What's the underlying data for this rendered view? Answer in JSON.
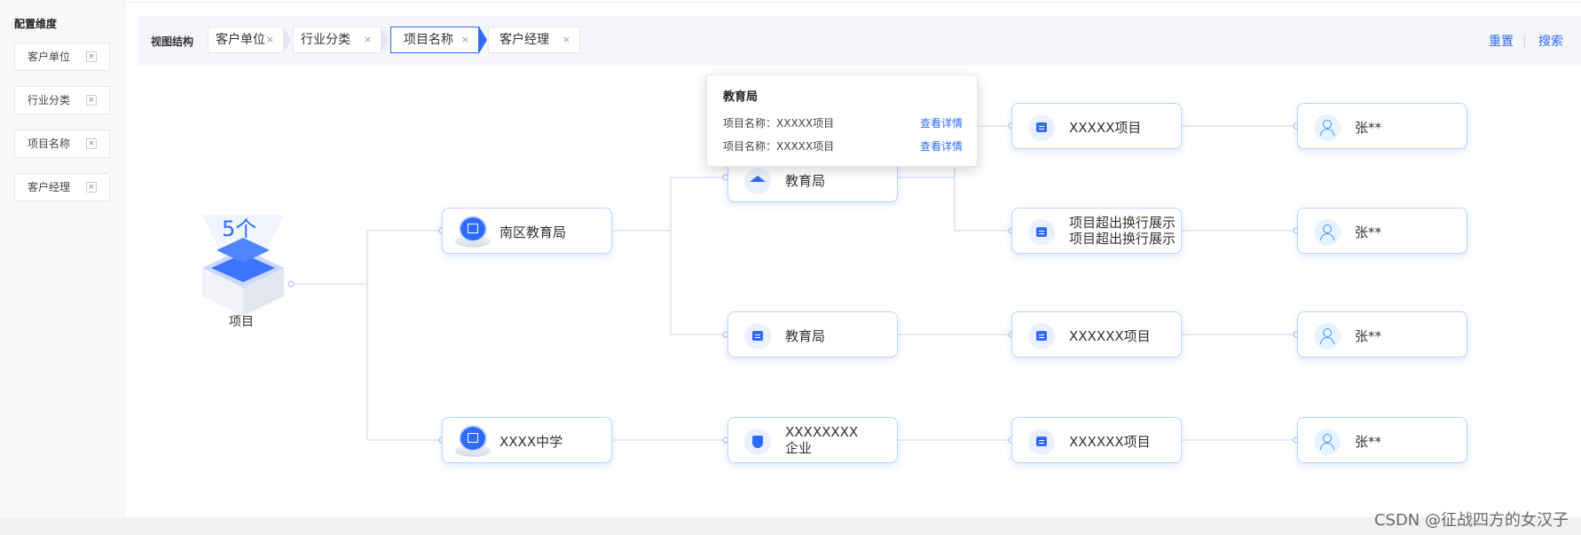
{
  "sidebar": {
    "title": "配置维度",
    "items": [
      {
        "label": "客户单位"
      },
      {
        "label": "行业分类"
      },
      {
        "label": "项目名称"
      },
      {
        "label": "客户经理"
      }
    ]
  },
  "header": {
    "view_label": "视图结构",
    "crumbs": [
      {
        "label": "客户单位"
      },
      {
        "label": "行业分类"
      },
      {
        "label": "项目名称",
        "active": true
      },
      {
        "label": "客户经理"
      }
    ],
    "reset_label": "重置",
    "search_label": "搜索",
    "close_glyph": "×"
  },
  "root": {
    "count": "5个",
    "label": "项目"
  },
  "graph": {
    "level1": [
      {
        "label": "南区教育局",
        "icon": "building-icon"
      },
      {
        "label": "XXXX中学",
        "icon": "school-icon"
      }
    ],
    "level2": [
      {
        "label": "教育局",
        "icon": "graduation-cap-icon"
      },
      {
        "label": "教育局",
        "icon": "folder-icon"
      },
      {
        "label_line1": "XXXXXXXX",
        "label_line2": "企业",
        "icon": "shield-icon"
      }
    ],
    "level3": [
      {
        "label": "XXXXX项目"
      },
      {
        "label_line1": "项目超出换行展示",
        "label_line2": "项目超出换行展示"
      },
      {
        "label": "XXXXXX项目"
      },
      {
        "label": "XXXXXX项目"
      }
    ],
    "level4": [
      {
        "label": "张**"
      },
      {
        "label": "张**"
      },
      {
        "label": "张**"
      },
      {
        "label": "张**"
      }
    ]
  },
  "tooltip": {
    "title": "教育局",
    "rows": [
      {
        "text": "项目名称：XXXXX项目",
        "link": "查看详情"
      },
      {
        "text": "项目名称：XXXXX项目",
        "link": "查看详情"
      }
    ]
  },
  "watermark": "CSDN @征战四方的女汉子",
  "colors": {
    "accent": "#2f6bff",
    "node_border": "#bcd4ff",
    "line": "#cfdcf5"
  }
}
